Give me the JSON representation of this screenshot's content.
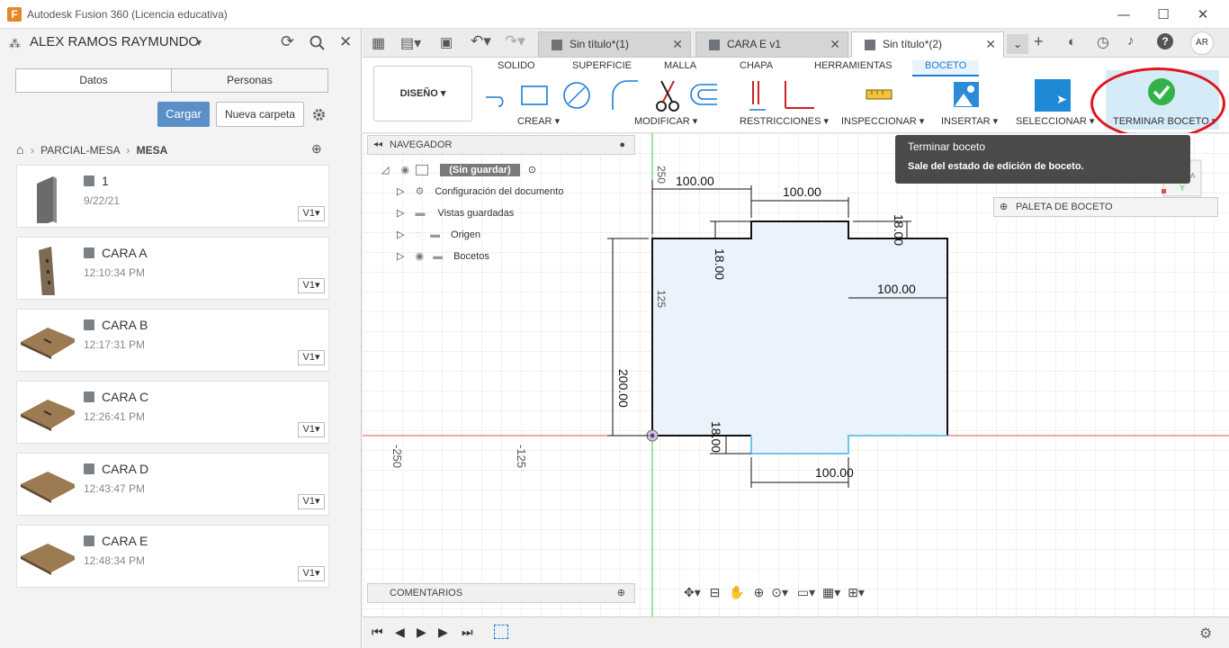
{
  "app": {
    "title": "Autodesk Fusion 360 (Licencia educativa)",
    "icon_letter": "F"
  },
  "window": {
    "minimize": "—",
    "maximize": "☐",
    "close": "✕"
  },
  "left": {
    "user": "ALEX RAMOS RAYMUNDO",
    "tabs": [
      "Datos",
      "Personas"
    ],
    "upload_btn": "Cargar",
    "new_folder_btn": "Nueva carpeta",
    "breadcrumb": {
      "parent": "PARCIAL-MESA",
      "current": "MESA"
    },
    "files": [
      {
        "name": "1",
        "time": "9/22/21",
        "version": "V1"
      },
      {
        "name": "CARA A",
        "time": "12:10:34 PM",
        "version": "V1"
      },
      {
        "name": "CARA B",
        "time": "12:17:31 PM",
        "version": "V1"
      },
      {
        "name": "CARA C",
        "time": "12:26:41 PM",
        "version": "V1"
      },
      {
        "name": "CARA D",
        "time": "12:43:47 PM",
        "version": "V1"
      },
      {
        "name": "CARA E",
        "time": "12:48:34 PM",
        "version": "V1"
      }
    ]
  },
  "doc_tabs": [
    {
      "label": "Sin título*(1)",
      "active": false
    },
    {
      "label": "CARA E v1",
      "active": false
    },
    {
      "label": "Sin título*(2)",
      "active": true
    }
  ],
  "user_initials": "AR",
  "ribbon": {
    "workspace": "DISEÑO",
    "tabs": [
      "SOLIDO",
      "SUPERFICIE",
      "MALLA",
      "CHAPA",
      "HERRAMIENTAS",
      "BOCETO"
    ],
    "active_tab": "BOCETO",
    "groups": [
      "CREAR",
      "MODIFICAR",
      "RESTRICCIONES",
      "INSPECCIONAR",
      "INSERTAR",
      "SELECCIONAR",
      "TERMINAR BOCETO"
    ]
  },
  "browser": {
    "title": "NAVEGADOR",
    "root": "(Sin guardar)",
    "items": [
      "Configuración del documento",
      "Vistas guardadas",
      "Origen",
      "Bocetos"
    ]
  },
  "tooltip": {
    "title": "Terminar boceto",
    "body": "Sale del estado de edición de boceto."
  },
  "palette": "PALETA DE BOCETO",
  "comments": "COMENTARIOS",
  "sketch_dims": {
    "top_left": "100.00",
    "top_mid": "100.00",
    "right_mid": "100.00",
    "bottom": "100.00",
    "height": "200.00",
    "notch_left": "18.00",
    "notch_right": "18.00",
    "notch_bottom": "18.00",
    "axis_250": "250",
    "axis_125": "125",
    "axis_neg250": "-250",
    "axis_neg125": "-125"
  },
  "colors": {
    "accent": "#1a7cd6",
    "highlight_ring": "#e0141c",
    "sketch_fill": "#eaf3fb",
    "axis_red": "#e05050",
    "axis_green": "#3cc43c"
  }
}
